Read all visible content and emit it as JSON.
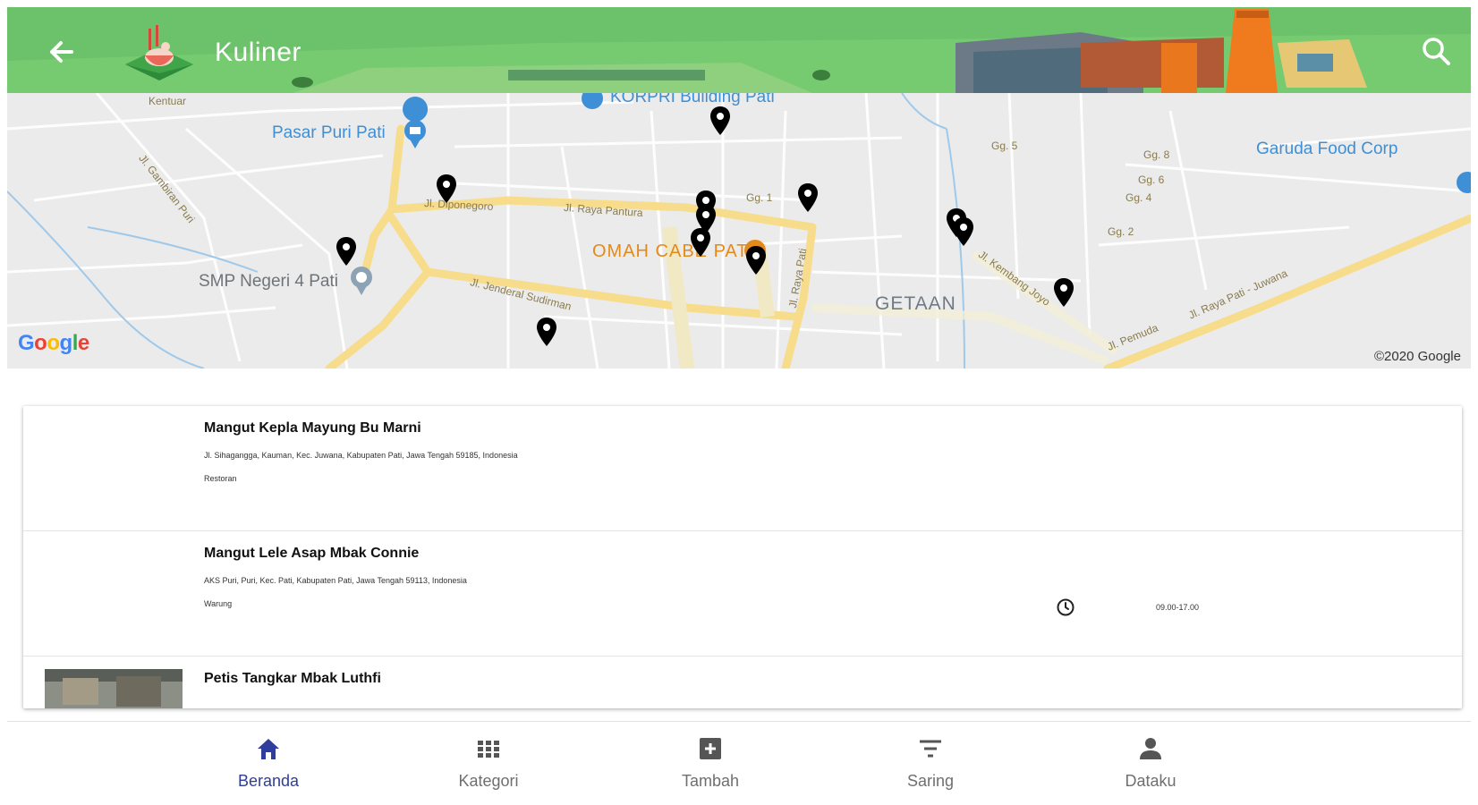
{
  "appbar": {
    "title": "Kuliner",
    "back_icon": "arrow-left-icon",
    "search_icon": "search-icon",
    "color": "#6cc26a"
  },
  "map": {
    "labels": {
      "korpri": "KORPRI Building Pati",
      "pasar": "Pasar Puri Pati",
      "garuda": "Garuda Food Corp",
      "omah": "OMAH CABE PATI",
      "smp": "SMP Negeri 4 Pati",
      "getaan": "GETAAN",
      "kentuar": "Kentuar",
      "diponegoro": "Jl. Diponegoro",
      "pantura": "Jl. Raya Pantura",
      "sudirman": "Jl. Jenderal Sudirman",
      "gambiran": "Jl. Gambiran Puri",
      "rayapati": "Jl. Raya Pati",
      "kembang": "Jl. Kembang Joyo",
      "pemuda": "Jl. Pemuda",
      "juwana": "Jl. Raya Pati - Juwana",
      "gg1": "Gg. 1",
      "gg2": "Gg. 2",
      "gg4": "Gg. 4",
      "gg5": "Gg. 5",
      "gg6": "Gg. 6",
      "gg8": "Gg. 8"
    },
    "google": "Google",
    "copyright": "©2020 Google",
    "accent_orange": "#e48a1b",
    "poi_blue": "#3e8fd6"
  },
  "places": [
    {
      "name": "Mangut Kepla Mayung Bu Marni",
      "address": "Jl. Sihagangga, Kauman, Kec. Juwana, Kabupaten Pati, Jawa Tengah 59185, Indonesia",
      "category": "Restoran",
      "hours": ""
    },
    {
      "name": "Mangut Lele Asap Mbak Connie",
      "address": "AKS Puri, Puri, Kec. Pati, Kabupaten Pati, Jawa Tengah 59113, Indonesia",
      "category": "Warung",
      "hours": "09.00-17.00",
      "clock_icon": "clock-icon"
    },
    {
      "name": "Petis Tangkar Mbak Luthfi",
      "address": "",
      "category": ""
    }
  ],
  "bottom_nav": {
    "items": [
      {
        "label": "Beranda",
        "icon": "home-icon",
        "active": true
      },
      {
        "label": "Kategori",
        "icon": "grid-icon",
        "active": false
      },
      {
        "label": "Tambah",
        "icon": "add-box-icon",
        "active": false
      },
      {
        "label": "Saring",
        "icon": "filter-icon",
        "active": false
      },
      {
        "label": "Dataku",
        "icon": "person-icon",
        "active": false
      }
    ],
    "active_color": "#2f3d9c"
  }
}
